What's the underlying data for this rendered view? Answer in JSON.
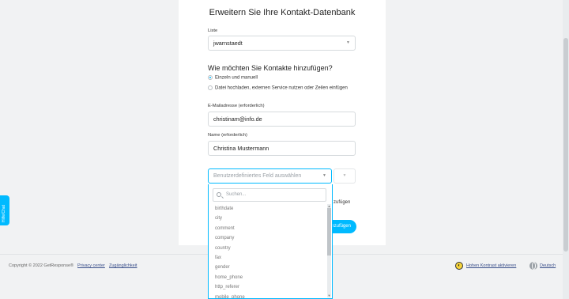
{
  "form": {
    "title": "Erweitern Sie Ihre Kontakt-Datenbank",
    "list_label": "Liste",
    "list_value": "jwarnstaedt",
    "question": "Wie möchten Sie Kontakte hinzufügen?",
    "radio_single": "Einzeln und manuell",
    "radio_file": "Datei hochladen, externen Service nutzen oder Zeilen einfügen",
    "email_label": "E-Mailadresse (erforderlich)",
    "email_value": "christinam@info.de",
    "name_label": "Name (erforderlich)",
    "name_value": "Christina Mustermann",
    "custom_field_placeholder": "Benutzerdefiniertes Feld auswählen",
    "peek_text": "zufügen",
    "submit_label": "nzufügen"
  },
  "dropdown": {
    "search_placeholder": "Suchen...",
    "items": [
      "birthdate",
      "city",
      "comment",
      "company",
      "country",
      "fax",
      "gender",
      "home_phone",
      "http_referer",
      "mobile_phone"
    ]
  },
  "footer": {
    "copyright": "Copyright © 2022 GetResponse®",
    "privacy": "Privacy center",
    "accessibility": "Zugänglichkeit",
    "contrast": "Hohen Kontrast aktivieren",
    "language": "Deutsch"
  },
  "help_tab": "Hilfe/Chat",
  "colors": {
    "accent": "#00baff",
    "background": "#f1f2f3"
  },
  "icons": {
    "dropdown_caret": "chevron-down-icon",
    "search": "search-icon",
    "contrast": "contrast-icon",
    "language": "globe-icon"
  }
}
